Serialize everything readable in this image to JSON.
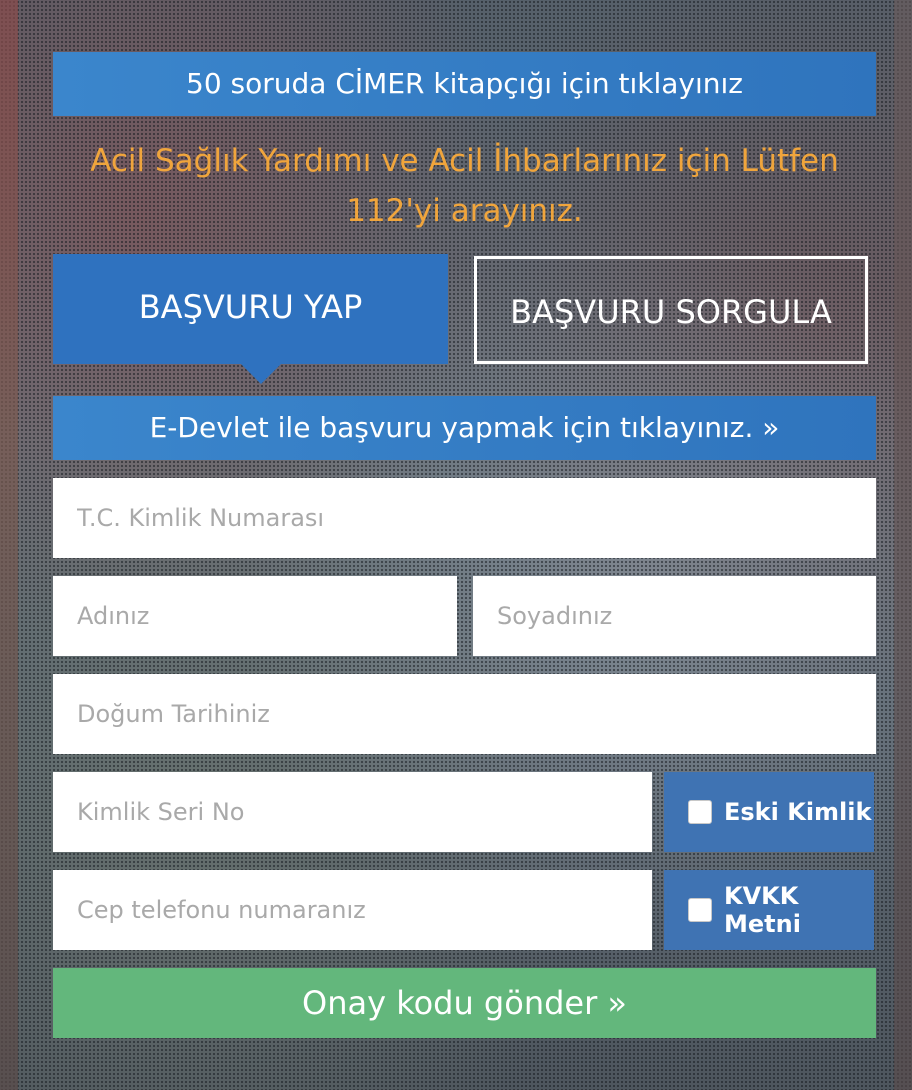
{
  "top_banner": {
    "label": "50 soruda CİMER kitapçığı için tıklayınız"
  },
  "notice": {
    "text": "Acil Sağlık Yardımı ve Acil İhbarlarınız için Lütfen 112'yi arayınız."
  },
  "tabs": [
    {
      "label": "BAŞVURU YAP",
      "active": true
    },
    {
      "label": "BAŞVURU SORGULA",
      "active": false
    }
  ],
  "edevlet": {
    "label": "E-Devlet ile başvuru yapmak için tıklayınız. »"
  },
  "form": {
    "tc_placeholder": "T.C. Kimlik Numarası",
    "name_placeholder": "Adınız",
    "surname_placeholder": "Soyadınız",
    "birth_placeholder": "Doğum Tarihiniz",
    "serial_placeholder": "Kimlik Seri No",
    "phone_placeholder": "Cep telefonu numaranız",
    "old_id_label": "Eski Kimlik",
    "kvkk_label": "KVKK Metni",
    "submit_label": "Onay kodu gönder »"
  },
  "colors": {
    "primary_blue": "#2f72bf",
    "notice_orange": "#f0a53c",
    "submit_green": "#63b77c",
    "checkbox_panel_blue": "#3f73b3"
  }
}
